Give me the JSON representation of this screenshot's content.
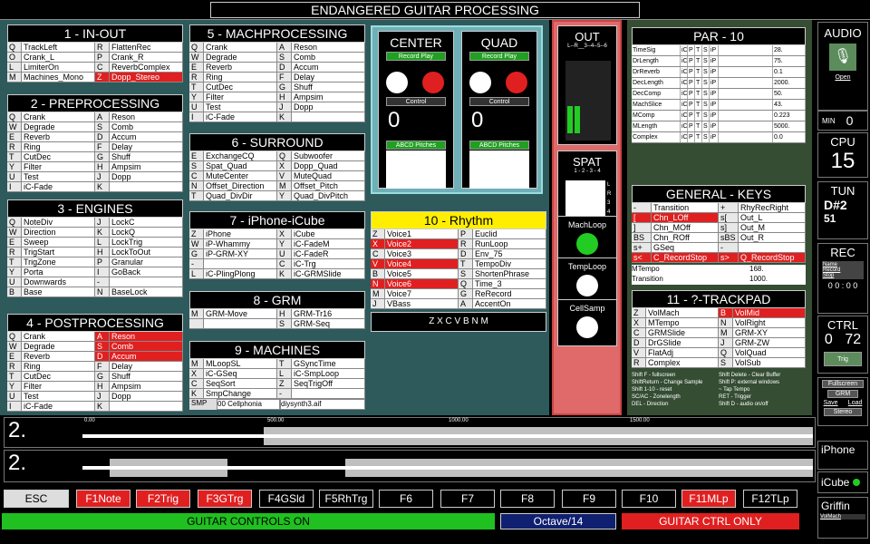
{
  "app_title": "ENDANGERED GUITAR PROCESSING",
  "panels": {
    "inout": {
      "title": "1 - IN-OUT",
      "rows": [
        [
          "Q",
          "TrackLeft",
          "R",
          "FlattenRec"
        ],
        [
          "O",
          "Crank_L",
          "P",
          "Crank_R"
        ],
        [
          "L",
          "LimiterOn",
          "C",
          "ReverbComplex"
        ],
        [
          "M",
          "Machines_Mono",
          "Z",
          "Dopp_Stereo"
        ]
      ]
    },
    "preprocessing": {
      "title": "2 - PREPROCESSING",
      "rows": [
        [
          "Q",
          "Crank",
          "A",
          "Reson"
        ],
        [
          "W",
          "Degrade",
          "S",
          "Comb"
        ],
        [
          "E",
          "Reverb",
          "D",
          "Accum"
        ],
        [
          "R",
          "Ring",
          "F",
          "Delay"
        ],
        [
          "T",
          "CutDec",
          "G",
          "Shuff"
        ],
        [
          "Y",
          "Filter",
          "H",
          "Ampsim"
        ],
        [
          "U",
          "Test",
          "J",
          "Dopp"
        ],
        [
          "I",
          "iC-Fade",
          "K",
          ""
        ]
      ]
    },
    "engines": {
      "title": "3 - ENGINES",
      "rows": [
        [
          "Q",
          "NoteDiv",
          "J",
          "LockC"
        ],
        [
          "W",
          "Direction",
          "K",
          "LockQ"
        ],
        [
          "E",
          "Sweep",
          "L",
          "LockTrig"
        ],
        [
          "R",
          "TrigStart",
          "H",
          "LockToOut"
        ],
        [
          "T",
          "TrigZone",
          "P",
          "Granular"
        ],
        [
          "Y",
          "Porta",
          "I",
          "GoBack"
        ],
        [
          "U",
          "Downwards",
          "-",
          ""
        ],
        [
          "B",
          "Base",
          "N",
          "BaseLock"
        ]
      ]
    },
    "postprocessing": {
      "title": "4 - POSTPROCESSING",
      "rows": [
        [
          "Q",
          "Crank",
          "A",
          "Reson"
        ],
        [
          "W",
          "Degrade",
          "S",
          "Comb"
        ],
        [
          "E",
          "Reverb",
          "D",
          "Accum"
        ],
        [
          "R",
          "Ring",
          "F",
          "Delay"
        ],
        [
          "T",
          "CutDec",
          "G",
          "Shuff"
        ],
        [
          "Y",
          "Filter",
          "H",
          "Ampsim"
        ],
        [
          "U",
          "Test",
          "J",
          "Dopp"
        ],
        [
          "I",
          "iC-Fade",
          "K",
          ""
        ]
      ]
    },
    "machprocessing": {
      "title": "5 - MACHPROCESSING",
      "rows": [
        [
          "Q",
          "Crank",
          "A",
          "Reson"
        ],
        [
          "W",
          "Degrade",
          "S",
          "Comb"
        ],
        [
          "E",
          "Reverb",
          "D",
          "Accum"
        ],
        [
          "R",
          "Ring",
          "F",
          "Delay"
        ],
        [
          "T",
          "CutDec",
          "G",
          "Shuff"
        ],
        [
          "Y",
          "Filter",
          "H",
          "Ampsim"
        ],
        [
          "U",
          "Test",
          "J",
          "Dopp"
        ],
        [
          "I",
          "iC-Fade",
          "K",
          ""
        ]
      ]
    },
    "surround": {
      "title": "6 - SURROUND",
      "rows": [
        [
          "E",
          "ExchangeCQ",
          "Q",
          "Subwoofer"
        ],
        [
          "S",
          "Spat_Quad",
          "X",
          "Dopp_Quad"
        ],
        [
          "C",
          "MuteCenter",
          "V",
          "MuteQuad"
        ],
        [
          "N",
          "Offset_Direction",
          "M",
          "Offset_Pitch"
        ],
        [
          "T",
          "Quad_DivDir",
          "Y",
          "Quad_DivPitch"
        ]
      ]
    },
    "iphone": {
      "title": "7 - iPhone-iCube",
      "rows": [
        [
          "Z",
          "iPhone",
          "X",
          "iCube"
        ],
        [
          "W",
          "iP-Whammy",
          "Y",
          "iC-FadeM"
        ],
        [
          "G",
          "iP-GRM-XY",
          "U",
          "iC-FadeR"
        ],
        [
          "-",
          "",
          "C",
          "iC-Trg"
        ],
        [
          "L",
          "iC-PlingPlong",
          "K",
          "iC-GRMSlide"
        ]
      ]
    },
    "grm": {
      "title": "8 - GRM",
      "rows": [
        [
          "M",
          "GRM-Move",
          "H",
          "GRM-Tr16"
        ],
        [
          "",
          "",
          "S",
          "GRM-Seq"
        ]
      ]
    },
    "machines": {
      "title": "9 - MACHINES",
      "rows": [
        [
          "M",
          "MLoopSL",
          "T",
          "GSyncTime"
        ],
        [
          "X",
          "iC-GSeq",
          "L",
          "iC-SmpLoop"
        ],
        [
          "C",
          "SeqSort",
          "Z",
          "SeqTrigOff"
        ],
        [
          "K",
          "SmpChange",
          "-",
          ""
        ]
      ],
      "smp_label": "SMP",
      "smp_select": "00 Cellphonia",
      "file_select": "diysynth3.aif"
    },
    "rhythm": {
      "title": "10 - Rhythm",
      "rows": [
        [
          "Z",
          "Voice1",
          "P",
          "Euclid"
        ],
        [
          "X",
          "Voice2",
          "R",
          "RunLoop"
        ],
        [
          "C",
          "Voice3",
          "D",
          "Env_75"
        ],
        [
          "V",
          "Voice4",
          "T",
          "TempoDiv"
        ],
        [
          "B",
          "Voice5",
          "S",
          "ShortenPhrase"
        ],
        [
          "N",
          "Voice6",
          "Q",
          "Time_3"
        ],
        [
          "M",
          "Voice7",
          "G",
          "ReRecord"
        ],
        [
          "J",
          "VBass",
          "A",
          "AccentOn"
        ]
      ],
      "keys": "Z  X  C  V  B  N  M"
    },
    "par": {
      "title": "PAR - 10",
      "rows": [
        [
          "TimeSig",
          "iC",
          "P",
          "T",
          "S",
          "iP",
          "28."
        ],
        [
          "DrLength",
          "iC",
          "P",
          "T",
          "S",
          "iP",
          "75."
        ],
        [
          "DrReverb",
          "iC",
          "P",
          "T",
          "S",
          "iP",
          "0.1"
        ],
        [
          "DecLength",
          "iC",
          "P",
          "T",
          "S",
          "iP",
          "2000."
        ],
        [
          "DecComp",
          "iC",
          "P",
          "T",
          "S",
          "iP",
          "50."
        ],
        [
          "MachSlice",
          "iC",
          "P",
          "T",
          "S",
          "iP",
          "43."
        ],
        [
          "MComp",
          "iC",
          "P",
          "T",
          "S",
          "iP",
          "0.223"
        ],
        [
          "MLength",
          "iC",
          "P",
          "T",
          "S",
          "iP",
          "5000."
        ],
        [
          "Complex",
          "iC",
          "P",
          "T",
          "S",
          "iP",
          "0.0"
        ]
      ]
    },
    "genkeys": {
      "title": "GENERAL - KEYS",
      "rows": [
        [
          "-",
          "Transition",
          "+",
          "RhyRecRight"
        ],
        [
          "[",
          "Chn_LOff",
          "s[",
          "Out_L"
        ],
        [
          "]",
          "Chn_MOff",
          "s]",
          "Out_M"
        ],
        [
          "BS",
          "Chn_ROff",
          "sBS",
          "Out_R"
        ],
        [
          "s+",
          "GSeq",
          "-",
          ""
        ],
        [
          "s<",
          "C_RecordStop",
          "s>",
          "Q_RecordStop"
        ]
      ],
      "mtempo": "MTempo",
      "mtempo_val": "168.",
      "transition": "Transition",
      "transition_val": "1000."
    },
    "trackpad": {
      "title": "11 - ?-TRACKPAD",
      "rows": [
        [
          "Z",
          "VolMach",
          "B",
          "VolMid"
        ],
        [
          "X",
          "MTempo",
          "N",
          "VolRight"
        ],
        [
          "C",
          "GRMSlide",
          "M",
          "GRM-XY"
        ],
        [
          "D",
          "DrGSlide",
          "J",
          "GRM-ZW"
        ],
        [
          "V",
          "FlatAdj",
          "Q",
          "VolQuad"
        ],
        [
          "R",
          "Complex",
          "S",
          "VolSub"
        ]
      ],
      "shortcuts_left": [
        "Shift F - fullscreen",
        "ShiftReturn - Change Sample",
        "Shift 1-10 - reset",
        "SC/AC - Zonelength",
        "DEL - Direction"
      ],
      "shortcuts_right": [
        "Shift Delete - Clear Buffer",
        "Shift P: external windows",
        "~ Tap Tempo",
        "RET - Trigger",
        "Shift D - audio on/off"
      ]
    }
  },
  "center": {
    "title": "CENTER",
    "rec": "Record Play",
    "control": "Control",
    "value": "0",
    "pitches": "ABCD Pitches"
  },
  "quad": {
    "title": "QUAD",
    "rec": "Record Play",
    "control": "Control",
    "value": "0",
    "pitches": "ABCD Pitches"
  },
  "out": {
    "title": "OUT",
    "sub": "L--R__3--4--5--6"
  },
  "spat": {
    "title": "SPAT",
    "sub": "1 - 2 - 3 - 4",
    "side": "L R 3 4"
  },
  "knobs": {
    "machloop": "MachLoop",
    "temploop": "TempLoop",
    "cellsamp": "CellSamp"
  },
  "side": {
    "audio": "AUDIO",
    "open": "Open",
    "min": "MIN",
    "min_val": "0",
    "cpu": "CPU",
    "cpu_val": "15",
    "tun": "TUN",
    "tun_note": "D#2",
    "tun_val": "51",
    "rec": "REC",
    "rec_name": "Name",
    "rec_record": "Record",
    "rec_stop": "Stop",
    "rec_time": "0 0 : 0 0",
    "ctrl": "CTRL",
    "ctrl_a": "0",
    "ctrl_b": "72",
    "trig": "Trig",
    "fullscreen": "Fullscreen",
    "grm": "GRM",
    "save": "Save",
    "load": "Load",
    "stereo": "Stereo",
    "iphone": "iPhone",
    "icube": "iCube",
    "griffin": "Griffin",
    "volmach": "VolMach"
  },
  "waves": {
    "w1": "2.",
    "w2": "2.",
    "t0": "0.00",
    "t1": "500.00",
    "t2": "1000.00",
    "t3": "1500.00"
  },
  "fkeys": [
    "ESC",
    "F1Note",
    "F2Trig",
    "F3GTrg",
    "F4GSld",
    "F5RhTrg",
    "F6",
    "F7",
    "F8",
    "F9",
    "F10",
    "F11MLp",
    "F12TLp"
  ],
  "bottom": {
    "guitar": "GUITAR CONTROLS ON",
    "octave": "Octave/14",
    "ctrl_only": "GUITAR CTRL ONLY"
  },
  "colors": {
    "red": "#e02020",
    "green": "#20c020",
    "teal": "#2e5a5c",
    "accent_yellow": "#ffee00"
  }
}
